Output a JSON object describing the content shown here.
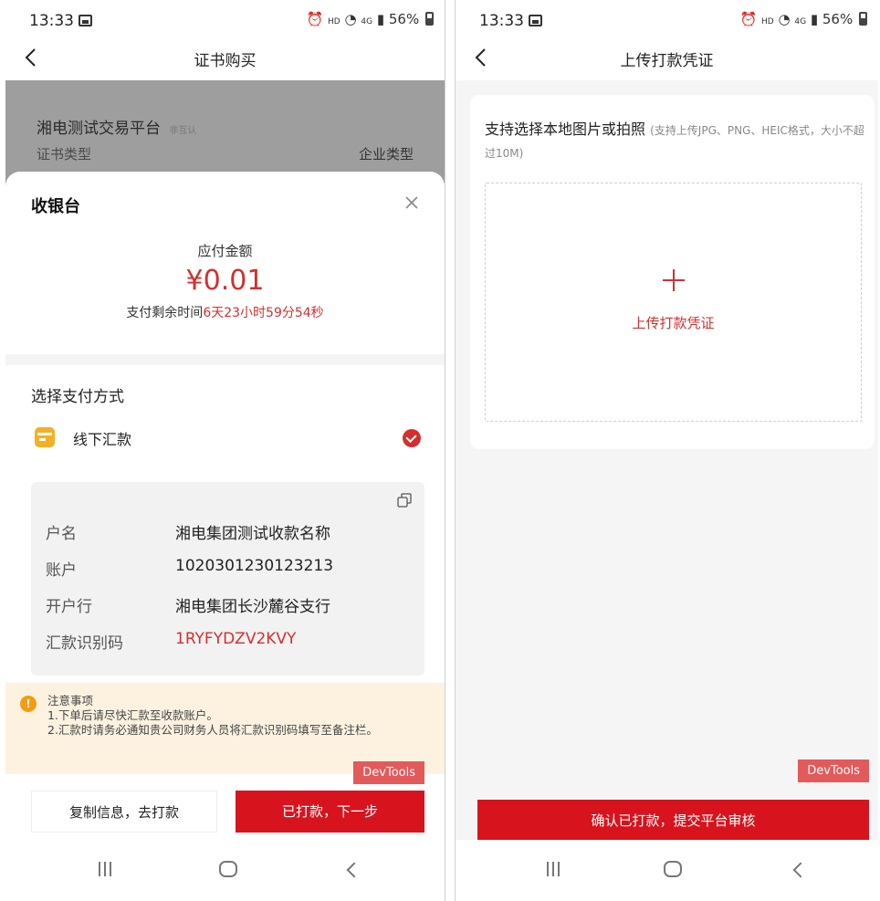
{
  "status_bar": {
    "time": "13:33",
    "right_text": "HD",
    "network": "4G",
    "battery": "56%"
  },
  "screen1": {
    "title": "证书购买",
    "background": {
      "platform_name": "湘电测试交易平台",
      "platform_tag": "非互认",
      "left_label": "证书类型",
      "right_label": "企业类型"
    },
    "cashier": {
      "title": "收银台",
      "amount_label": "应付金额",
      "amount": "¥0.01",
      "remaining_label": "支付剩余时间",
      "remaining_time": "6天23小时59分54秒",
      "pay_method_title": "选择支付方式",
      "method_label": "线下汇款",
      "account": {
        "rows": [
          {
            "key": "户名",
            "value": "湘电集团测试收款名称"
          },
          {
            "key": "账户",
            "value": "1020301230123213"
          },
          {
            "key": "开户行",
            "value": "湘电集团长沙麓谷支行"
          },
          {
            "key": "汇款识别码",
            "value": "1RYFYDZV2KVY"
          }
        ]
      },
      "notice": {
        "title": "注意事项",
        "line1": "1.下单后请尽快汇款至收款账户。",
        "line2": "2.汇款时请务必通知贵公司财务人员将汇款识别码填写至备注栏。"
      },
      "devtools": "DevTools",
      "copy_button": "复制信息，去打款",
      "next_button": "已打款，下一步"
    }
  },
  "screen2": {
    "title": "上传打款凭证",
    "support_text": "支持选择本地图片或拍照",
    "support_hint": "(支持上传JPG、PNG、HEIC格式，大小不超过10M)",
    "upload_label": "上传打款凭证",
    "devtools": "DevTools",
    "confirm_button": "确认已打款，提交平台审核"
  },
  "icons": {
    "back": "chevron-left-icon",
    "close": "close-icon",
    "copy": "copy-icon",
    "check": "check-circle-icon",
    "warning": "warning-icon",
    "payment": "bank-card-icon"
  },
  "colors": {
    "accent": "#d7141e",
    "warning": "#f39c12",
    "notice_bg": "#fdf2e0"
  }
}
